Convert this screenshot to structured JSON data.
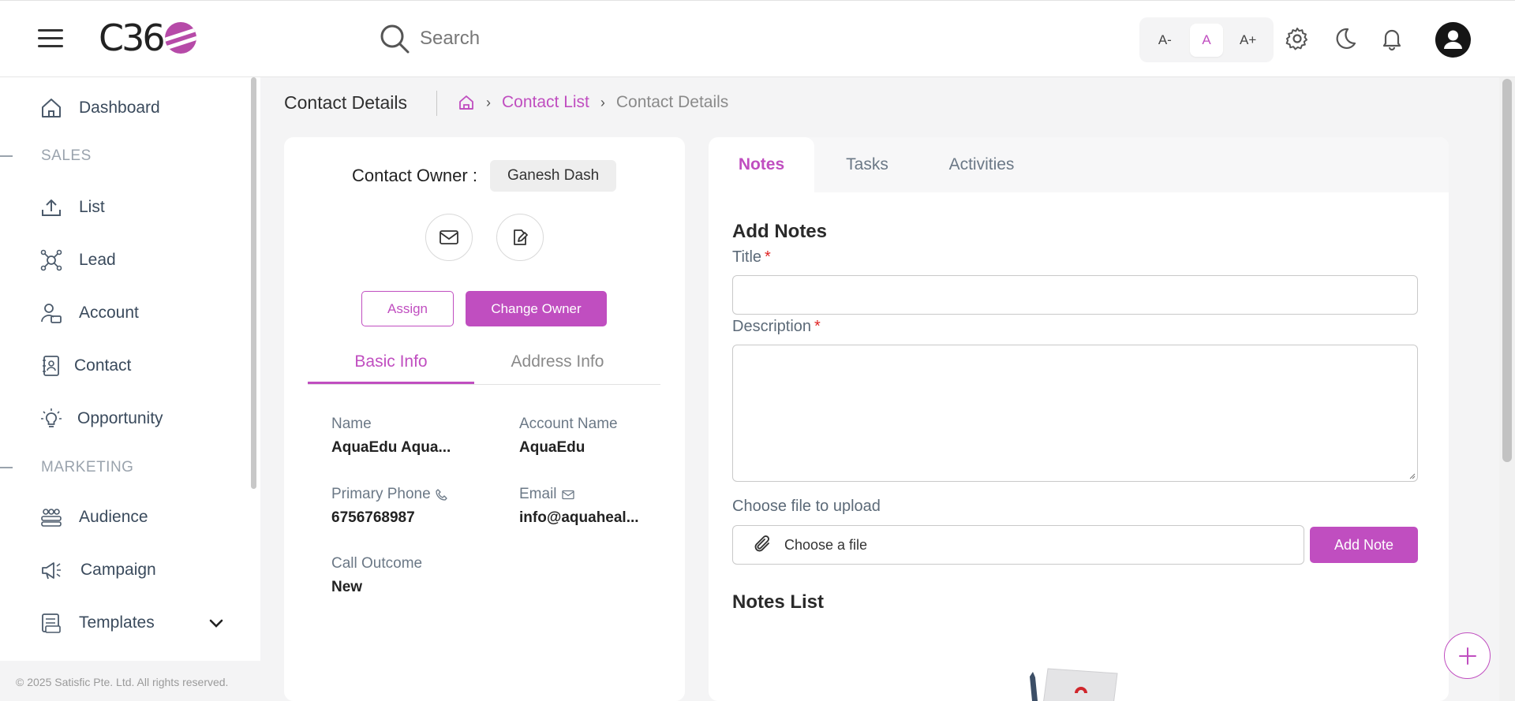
{
  "app": {
    "search_placeholder": "Search",
    "font_sizes": [
      "A-",
      "A",
      "A+"
    ],
    "active_font_size": "A",
    "accent_color": "#c04ec0"
  },
  "sidebar": {
    "items": [
      {
        "label": "Dashboard",
        "icon": "home-icon"
      },
      {
        "section": "SALES"
      },
      {
        "label": "List",
        "icon": "upload-icon"
      },
      {
        "label": "Lead",
        "icon": "network-icon"
      },
      {
        "label": "Account",
        "icon": "user-card-icon"
      },
      {
        "label": "Contact",
        "icon": "contact-book-icon"
      },
      {
        "label": "Opportunity",
        "icon": "lightbulb-icon"
      },
      {
        "section": "MARKETING"
      },
      {
        "label": "Audience",
        "icon": "group-icon"
      },
      {
        "label": "Campaign",
        "icon": "megaphone-icon"
      },
      {
        "label": "Templates",
        "icon": "template-icon"
      }
    ],
    "footer": "© 2025 Satisfic Pte. Ltd. All rights reserved."
  },
  "breadcrumb": {
    "page_title": "Contact Details",
    "link": "Contact List",
    "current": "Contact Details"
  },
  "contact": {
    "owner_label": "Contact Owner :",
    "owner_name": "Ganesh Dash",
    "assign_label": "Assign",
    "change_owner_label": "Change Owner",
    "tabs": [
      "Basic Info",
      "Address Info"
    ],
    "active_tab": "Basic Info",
    "fields": {
      "name_label": "Name",
      "name_value": "AquaEdu Aqua...",
      "account_label": "Account Name",
      "account_value": "AquaEdu",
      "phone_label": "Primary Phone",
      "phone_value": "6756768987",
      "email_label": "Email",
      "email_value": "info@aquaheal...",
      "outcome_label": "Call Outcome",
      "outcome_value": "New"
    }
  },
  "notes": {
    "tabs": [
      "Notes",
      "Tasks",
      "Activities"
    ],
    "active_tab": "Notes",
    "add_title": "Add Notes",
    "title_label": "Title",
    "description_label": "Description",
    "required_mark": "*",
    "file_label": "Choose file to upload",
    "file_button": "Choose a file",
    "add_button": "Add Note",
    "list_title": "Notes List"
  }
}
